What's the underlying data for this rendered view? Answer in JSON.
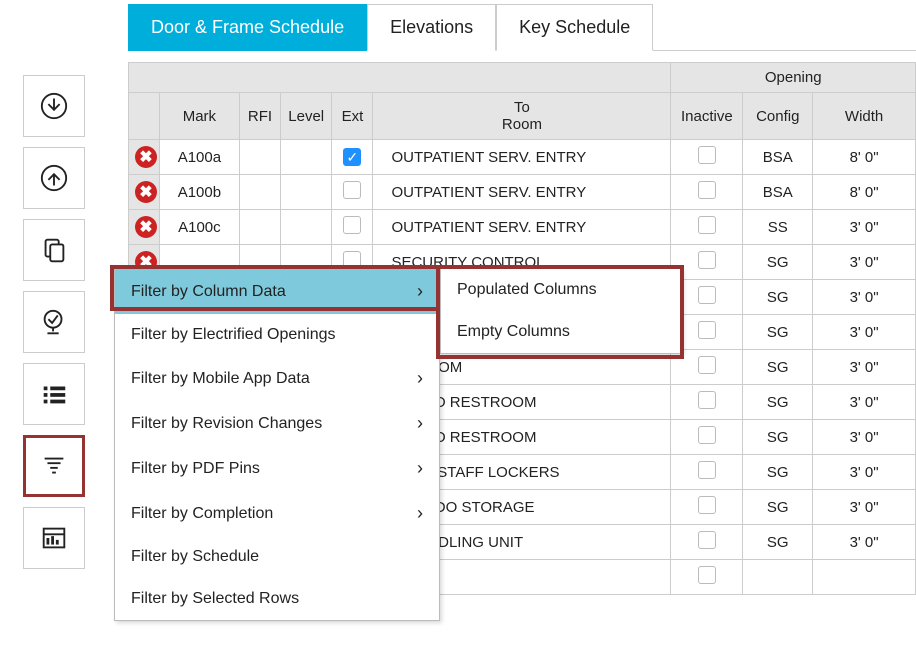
{
  "tabs": [
    {
      "label": "Door & Frame Schedule",
      "active": true
    },
    {
      "label": "Elevations",
      "active": false
    },
    {
      "label": "Key Schedule",
      "active": false
    }
  ],
  "sidebar_icons": [
    "download-icon",
    "upload-icon",
    "copy-icon",
    "globe-check-icon",
    "list-icon",
    "filter-icon",
    "dashboard-icon"
  ],
  "columns": {
    "group": "Opening",
    "headers": [
      "Mark",
      "RFI",
      "Level",
      "Ext",
      "To\nRoom",
      "Inactive",
      "Config",
      "Width"
    ]
  },
  "rows": [
    {
      "mark": "A100a",
      "ext": true,
      "room": "OUTPATIENT SERV. ENTRY",
      "inactive": false,
      "config": "BSA",
      "width": "8' 0\""
    },
    {
      "mark": "A100b",
      "ext": false,
      "room": "OUTPATIENT SERV. ENTRY",
      "inactive": false,
      "config": "BSA",
      "width": "8' 0\""
    },
    {
      "mark": "A100c",
      "ext": false,
      "room": "OUTPATIENT SERV. ENTRY",
      "inactive": false,
      "config": "SS",
      "width": "3' 0\""
    },
    {
      "mark": "",
      "ext": false,
      "room": "SECURITY CONTROL",
      "inactive": false,
      "config": "SG",
      "width": "3' 0\""
    },
    {
      "mark": "",
      "ext": false,
      "room": "",
      "inactive": false,
      "config": "SG",
      "width": "3' 0\""
    },
    {
      "mark": "",
      "ext": false,
      "room": "",
      "inactive": false,
      "config": "SG",
      "width": "3' 0\""
    },
    {
      "mark": "",
      "ext": false,
      "room": "I.T. ROOM",
      "inactive": false,
      "config": "SG",
      "width": "3' 0\""
    },
    {
      "mark": "",
      "ext": false,
      "room": "RNADO RESTROOM",
      "inactive": false,
      "config": "SG",
      "width": "3' 0\""
    },
    {
      "mark": "",
      "ext": false,
      "room": "RNADO RESTROOM",
      "inactive": false,
      "config": "SG",
      "width": "3' 0\""
    },
    {
      "mark": "",
      "ext": false,
      "room": "ADO - STAFF LOCKERS",
      "inactive": false,
      "config": "SG",
      "width": "3' 0\""
    },
    {
      "mark": "",
      "ext": false,
      "room": "ORNADO STORAGE",
      "inactive": false,
      "config": "SG",
      "width": "3' 0\""
    },
    {
      "mark": "",
      "ext": false,
      "room": "R HANDLING UNIT",
      "inactive": false,
      "config": "SG",
      "width": "3' 0\""
    },
    {
      "mark": "",
      "ext": false,
      "room": "",
      "inactive": false,
      "config": "",
      "width": ""
    }
  ],
  "menu": {
    "items": [
      {
        "label": "Filter by Column Data",
        "has_submenu": true,
        "active": true
      },
      {
        "label": "Filter by Electrified Openings",
        "has_submenu": false,
        "active": false
      },
      {
        "label": "Filter by Mobile App Data",
        "has_submenu": true,
        "active": false
      },
      {
        "label": "Filter by Revision Changes",
        "has_submenu": true,
        "active": false
      },
      {
        "label": "Filter by PDF Pins",
        "has_submenu": true,
        "active": false
      },
      {
        "label": "Filter by Completion",
        "has_submenu": true,
        "active": false
      },
      {
        "label": "Filter by Schedule",
        "has_submenu": false,
        "active": false
      },
      {
        "label": "Filter by Selected Rows",
        "has_submenu": false,
        "active": false
      }
    ],
    "submenu": [
      {
        "label": "Populated Columns"
      },
      {
        "label": "Empty Columns"
      }
    ]
  }
}
